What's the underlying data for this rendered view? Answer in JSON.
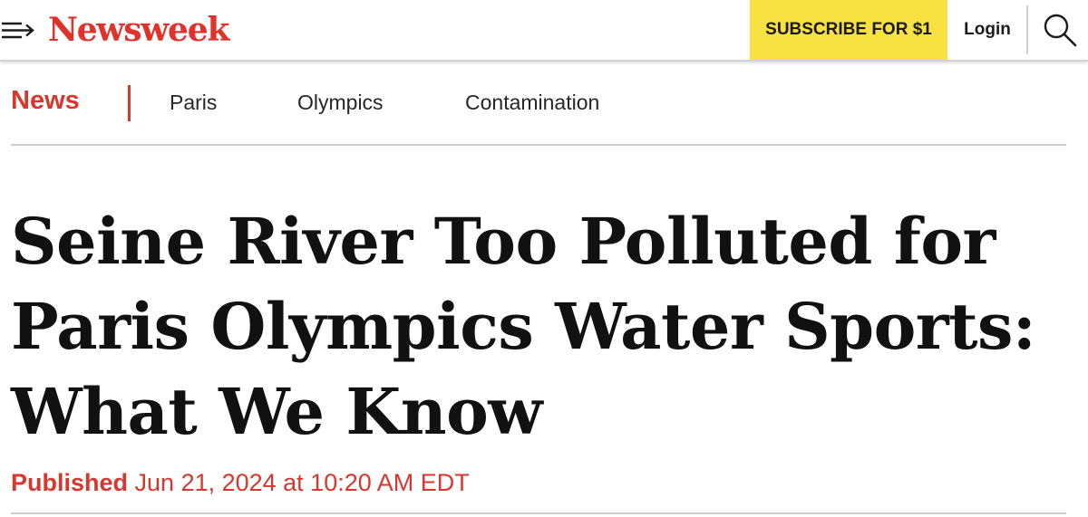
{
  "header": {
    "logo": "Newsweek",
    "subscribe_label": "SUBSCRIBE FOR $1",
    "login_label": "Login",
    "menu_icon": "menu-arrow-icon",
    "search_icon": "search-icon"
  },
  "subnav": {
    "section": "News",
    "tags": [
      "Paris",
      "Olympics",
      "Contamination"
    ]
  },
  "article": {
    "headline": "Seine River Too Polluted for Paris Olympics Water Sports: What We Know",
    "published_label": "Published",
    "published_date": "Jun 21, 2024 at 10:20 AM EDT"
  },
  "colors": {
    "brand_red": "#e0312b",
    "subscribe_yellow": "#f8e142"
  }
}
